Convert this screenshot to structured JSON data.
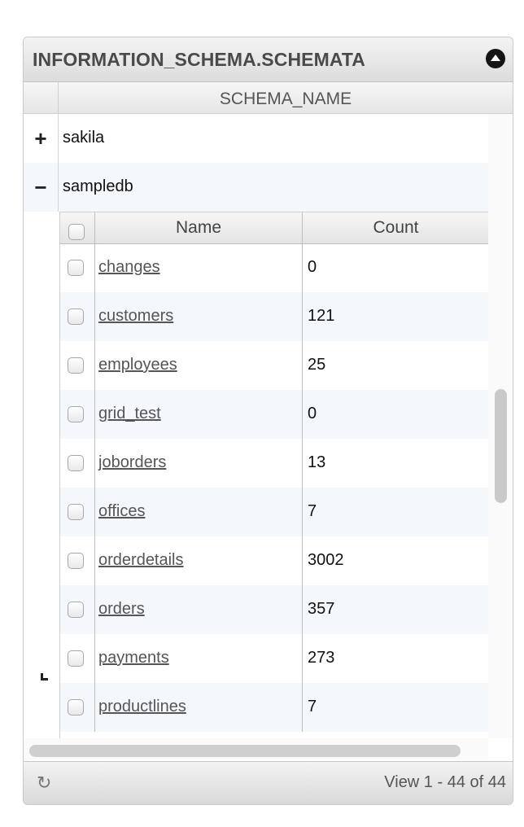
{
  "grid": {
    "title": "INFORMATION_SCHEMA.SCHEMATA",
    "column_header": "SCHEMA_NAME",
    "schemas": [
      {
        "toggle": "+",
        "name": "sakila"
      },
      {
        "toggle": "−",
        "name": "sampledb"
      }
    ]
  },
  "subgrid": {
    "columns": {
      "name": "Name",
      "count": "Count"
    },
    "rows": [
      {
        "name": "changes",
        "count": "0"
      },
      {
        "name": "customers",
        "count": "121"
      },
      {
        "name": "employees",
        "count": "25"
      },
      {
        "name": "grid_test",
        "count": "0"
      },
      {
        "name": "joborders",
        "count": "13"
      },
      {
        "name": "offices",
        "count": "7"
      },
      {
        "name": "orderdetails",
        "count": "3002"
      },
      {
        "name": "orders",
        "count": "357"
      },
      {
        "name": "payments",
        "count": "273"
      },
      {
        "name": "productlines",
        "count": "7"
      }
    ]
  },
  "pager": {
    "refresh_icon": "refresh-icon",
    "view_text": "View 1 - 44 of 44"
  }
}
